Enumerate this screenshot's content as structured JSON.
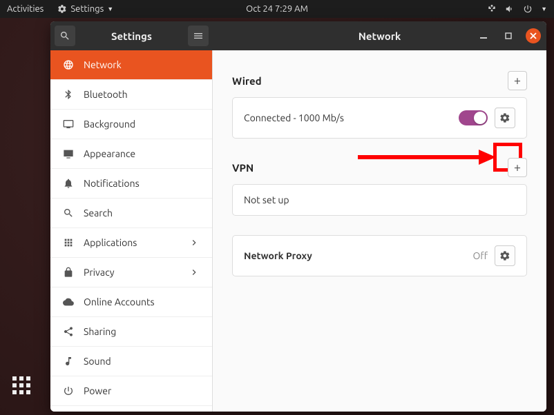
{
  "topbar": {
    "activities": "Activities",
    "app_menu": "Settings",
    "clock": "Oct 24  7:29 AM"
  },
  "window": {
    "left_title": "Settings",
    "right_title": "Network"
  },
  "sidebar": [
    {
      "icon": "globe",
      "label": "Network",
      "active": true
    },
    {
      "icon": "bluetooth",
      "label": "Bluetooth"
    },
    {
      "icon": "display",
      "label": "Background"
    },
    {
      "icon": "desktop",
      "label": "Appearance"
    },
    {
      "icon": "bell",
      "label": "Notifications"
    },
    {
      "icon": "search",
      "label": "Search"
    },
    {
      "icon": "apps",
      "label": "Applications",
      "chev": true
    },
    {
      "icon": "lock",
      "label": "Privacy",
      "chev": true
    },
    {
      "icon": "cloud",
      "label": "Online Accounts"
    },
    {
      "icon": "share",
      "label": "Sharing"
    },
    {
      "icon": "music",
      "label": "Sound"
    },
    {
      "icon": "power",
      "label": "Power"
    }
  ],
  "sections": {
    "wired": {
      "title": "Wired",
      "status": "Connected - 1000 Mb/s"
    },
    "vpn": {
      "title": "VPN",
      "status": "Not set up"
    },
    "proxy": {
      "title": "Network Proxy",
      "state": "Off"
    }
  }
}
